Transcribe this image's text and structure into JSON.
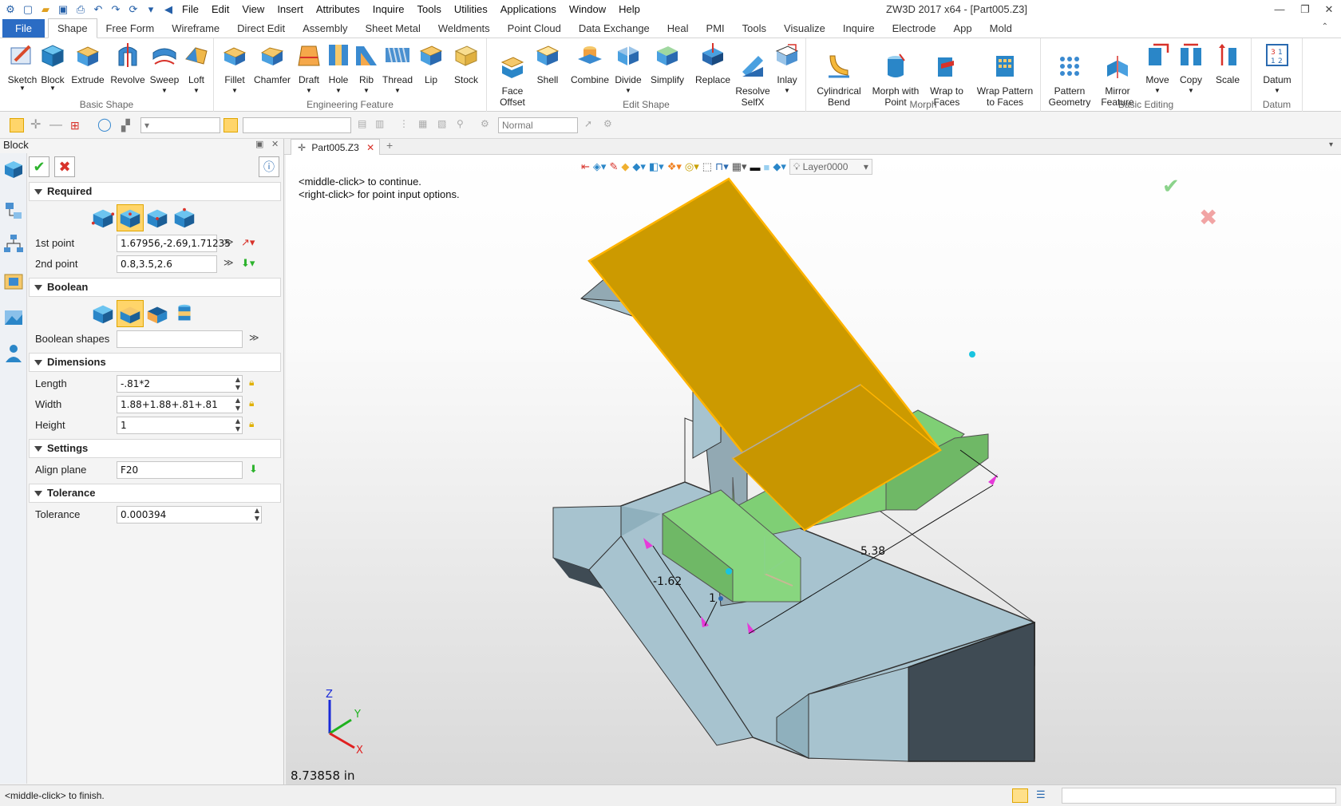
{
  "titlebar": {
    "menus": [
      "File",
      "Edit",
      "View",
      "Insert",
      "Attributes",
      "Inquire",
      "Tools",
      "Utilities",
      "Applications",
      "Window",
      "Help"
    ],
    "window_title": "ZW3D 2017  x64 - [Part005.Z3]"
  },
  "ribbon_tabs": [
    "File",
    "Shape",
    "Free Form",
    "Wireframe",
    "Direct Edit",
    "Assembly",
    "Sheet Metal",
    "Weldments",
    "Point Cloud",
    "Data Exchange",
    "Heal",
    "PMI",
    "Tools",
    "Visualize",
    "Inquire",
    "Electrode",
    "App",
    "Mold"
  ],
  "ribbon": {
    "basic_shape": {
      "label": "Basic Shape",
      "buttons": [
        "Sketch",
        "Block",
        "Extrude",
        "Revolve",
        "Sweep",
        "Loft"
      ]
    },
    "engineering_feature": {
      "label": "Engineering Feature",
      "buttons": [
        "Fillet",
        "Chamfer",
        "Draft",
        "Hole",
        "Rib",
        "Thread",
        "Lip",
        "Stock"
      ]
    },
    "edit_shape": {
      "label": "Edit Shape",
      "buttons": [
        "Face\nOffset",
        "Shell",
        "Combine",
        "Divide",
        "Simplify",
        "Replace",
        "Resolve\nSelfX",
        "Inlay"
      ]
    },
    "morph": {
      "label": "Morph",
      "buttons": [
        "Cylindrical\nBend",
        "Morph with\nPoint",
        "Wrap to\nFaces",
        "Wrap Pattern\nto Faces"
      ]
    },
    "basic_editing": {
      "label": "Basic Editing",
      "buttons": [
        "Pattern\nGeometry",
        "Mirror\nFeature",
        "Move",
        "Copy",
        "Scale"
      ]
    },
    "datum": {
      "label": "Datum",
      "buttons": [
        "Datum"
      ]
    }
  },
  "toolbar2": {
    "render_mode": "Normal"
  },
  "panel": {
    "title": "Block",
    "required": {
      "label": "Required",
      "first_point_label": "1st point",
      "first_point": "1.67956,-2.69,1.71235",
      "second_point_label": "2nd point",
      "second_point": "0.8,3.5,2.6"
    },
    "boolean": {
      "label": "Boolean",
      "shapes_label": "Boolean shapes",
      "shapes": ""
    },
    "dimensions": {
      "label": "Dimensions",
      "length_label": "Length",
      "length": "-.81*2",
      "width_label": "Width",
      "width": "1.88+1.88+.81+.81",
      "height_label": "Height",
      "height": "1"
    },
    "settings": {
      "label": "Settings",
      "align_plane_label": "Align plane",
      "align_plane": "F20"
    },
    "tolerance": {
      "label": "Tolerance",
      "tolerance_label": "Tolerance",
      "tolerance": "0.000394"
    }
  },
  "doc_tab": "Part005.Z3",
  "viewport": {
    "prompt_line1": "<middle-click> to continue.",
    "prompt_line2": "<right-click> for point input options.",
    "layer": "Layer0000",
    "dim_length": "-1.62",
    "dim_width": "5.38",
    "dim_height": "1",
    "measure": "8.73858 in",
    "axis_x": "X",
    "axis_y": "Y",
    "axis_z": "Z"
  },
  "status": {
    "text": "<middle-click> to finish."
  },
  "colors": {
    "accent": "#2b6cc4",
    "preview_box": "#88d67f",
    "selected_face": "#cc9a00",
    "part": "#a9c3cf",
    "part_dark": "#3f4b54"
  }
}
